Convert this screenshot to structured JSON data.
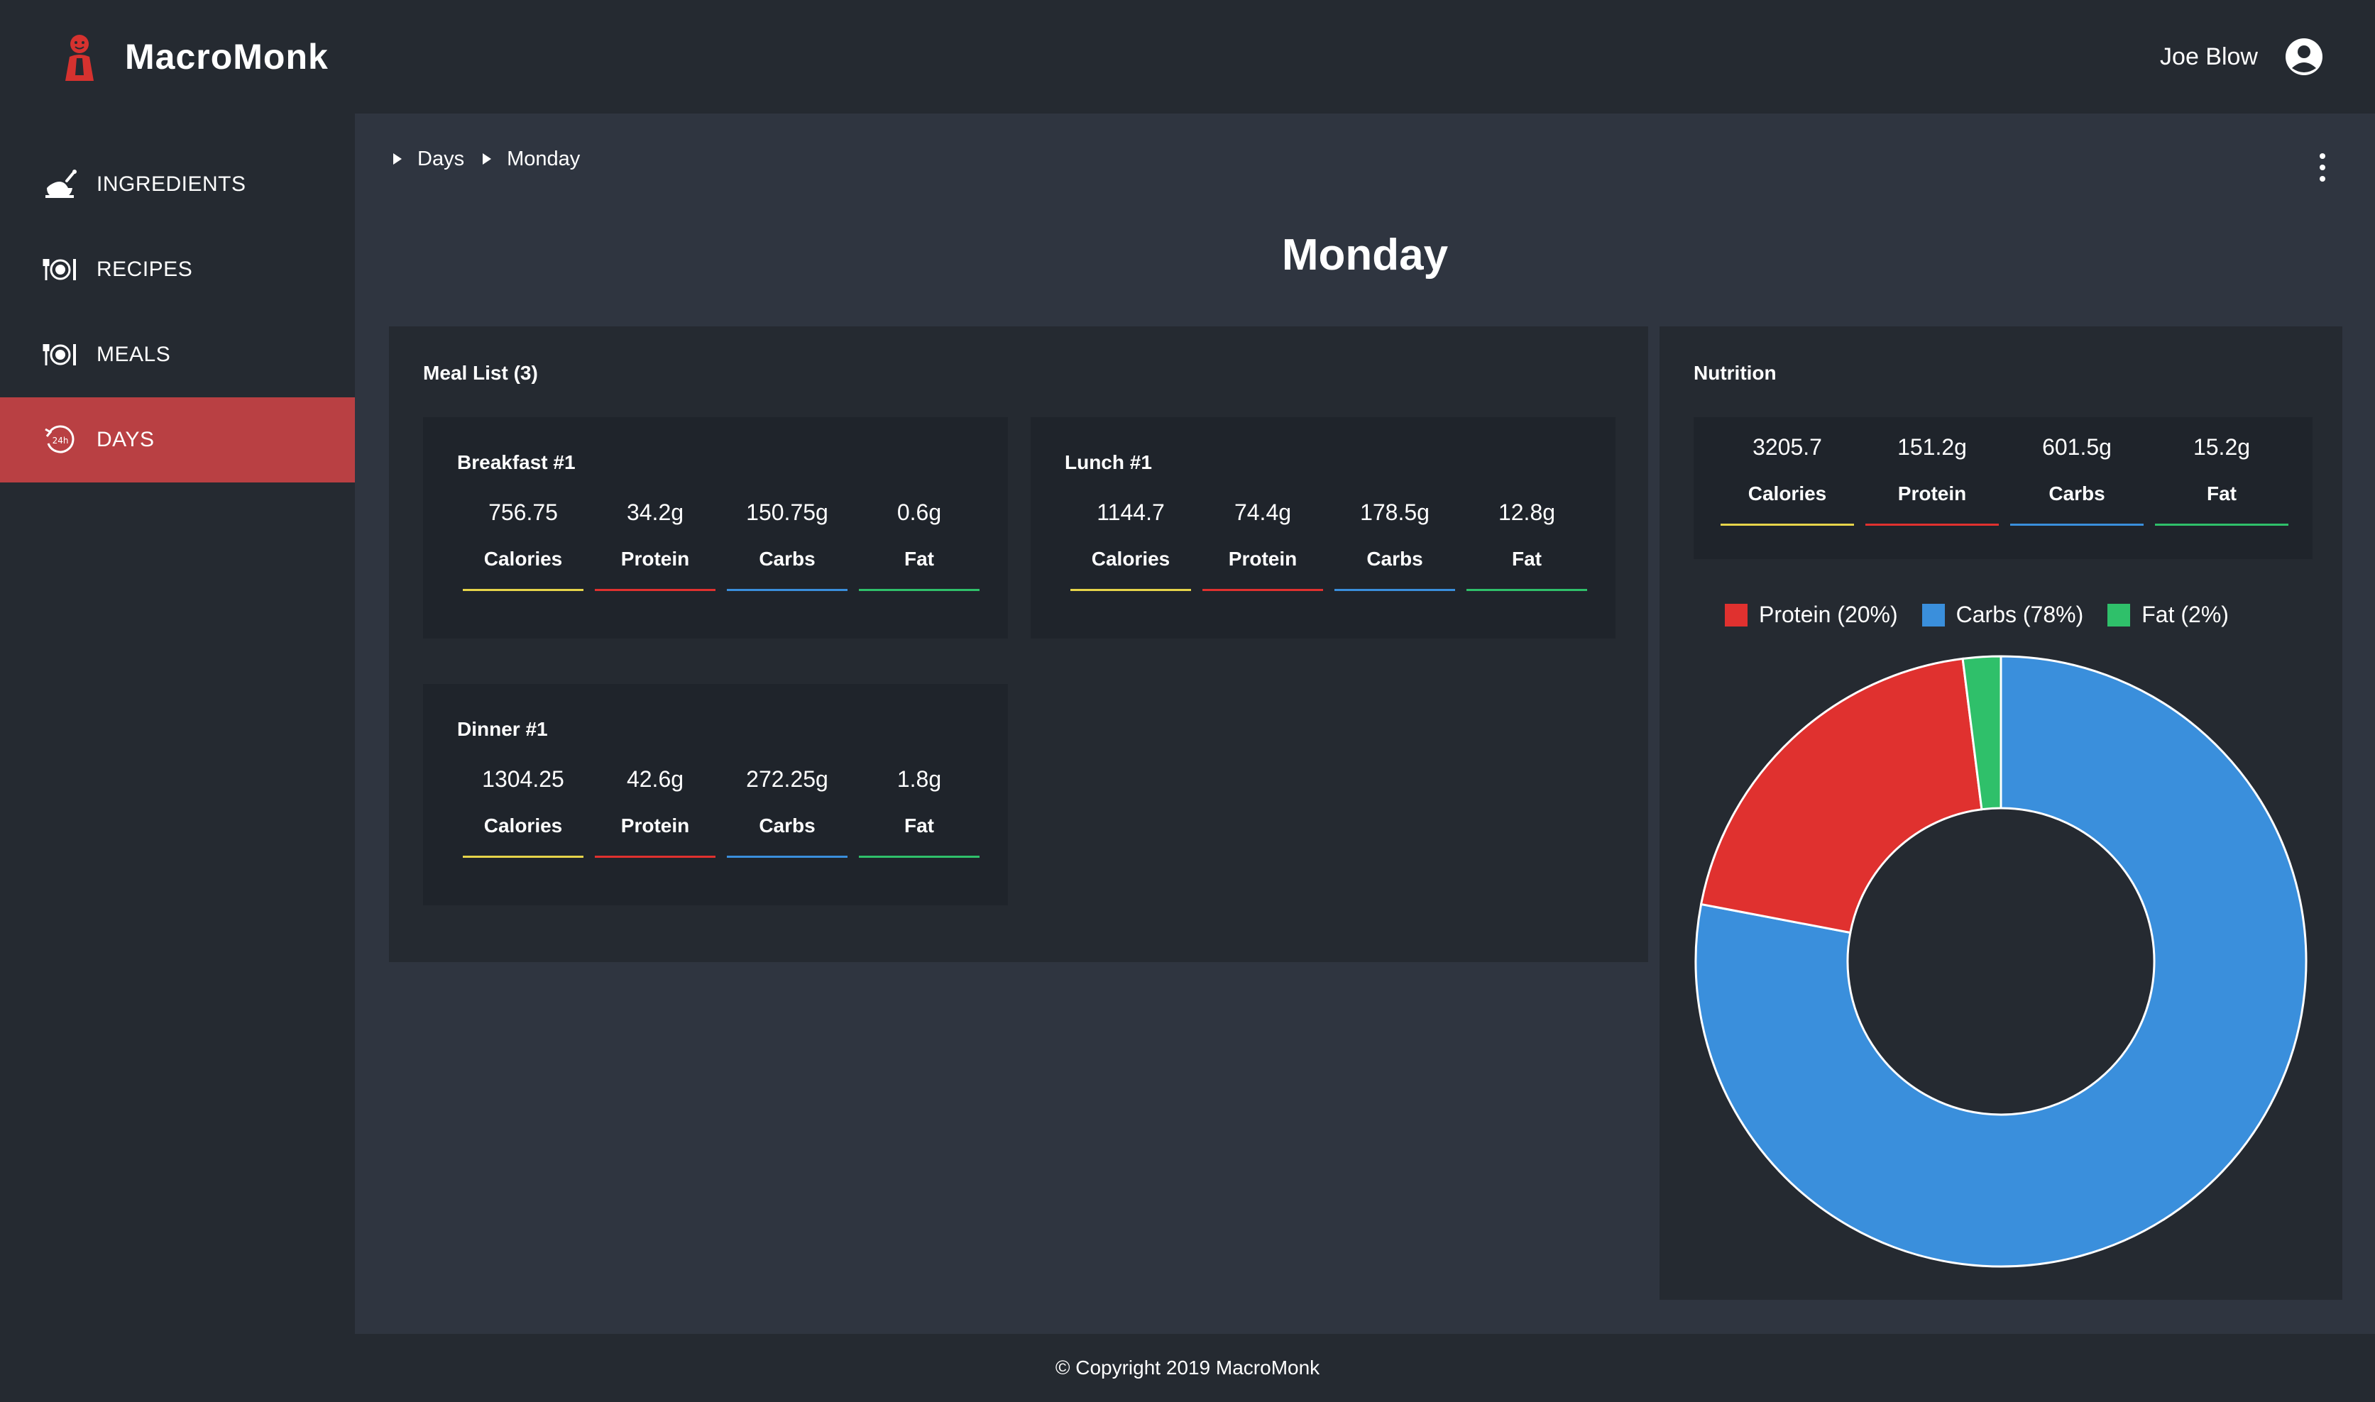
{
  "app": {
    "brand": "MacroMonk"
  },
  "user": {
    "name": "Joe Blow"
  },
  "colors": {
    "accent": "#b94043",
    "calories": "#e6d44a",
    "protein": "#e0312f",
    "carbs": "#3a8fdc",
    "fat": "#2fc06a"
  },
  "sidebar": {
    "items": [
      {
        "label": "INGREDIENTS",
        "icon": "chicken-icon"
      },
      {
        "label": "RECIPES",
        "icon": "plate-cutlery-icon"
      },
      {
        "label": "MEALS",
        "icon": "plate-cutlery-icon"
      },
      {
        "label": "DAYS",
        "icon": "24h-clock-icon",
        "active": true
      }
    ]
  },
  "breadcrumb": [
    "Days",
    "Monday"
  ],
  "page": {
    "title": "Monday"
  },
  "meal_list": {
    "title": "Meal List (3)",
    "meals": [
      {
        "name": "Breakfast #1",
        "stats": [
          {
            "value": "756.75",
            "label": "Calories"
          },
          {
            "value": "34.2g",
            "label": "Protein"
          },
          {
            "value": "150.75g",
            "label": "Carbs"
          },
          {
            "value": "0.6g",
            "label": "Fat"
          }
        ]
      },
      {
        "name": "Lunch #1",
        "stats": [
          {
            "value": "1144.7",
            "label": "Calories"
          },
          {
            "value": "74.4g",
            "label": "Protein"
          },
          {
            "value": "178.5g",
            "label": "Carbs"
          },
          {
            "value": "12.8g",
            "label": "Fat"
          }
        ]
      },
      {
        "name": "Dinner #1",
        "stats": [
          {
            "value": "1304.25",
            "label": "Calories"
          },
          {
            "value": "42.6g",
            "label": "Protein"
          },
          {
            "value": "272.25g",
            "label": "Carbs"
          },
          {
            "value": "1.8g",
            "label": "Fat"
          }
        ]
      }
    ]
  },
  "nutrition": {
    "title": "Nutrition",
    "stats": [
      {
        "value": "3205.7",
        "label": "Calories"
      },
      {
        "value": "151.2g",
        "label": "Protein"
      },
      {
        "value": "601.5g",
        "label": "Carbs"
      },
      {
        "value": "15.2g",
        "label": "Fat"
      }
    ]
  },
  "chart_data": {
    "type": "pie",
    "donut": true,
    "legend_position": "top",
    "categories": [
      "Protein (20%)",
      "Carbs (78%)",
      "Fat (2%)"
    ],
    "values": [
      20,
      78,
      2
    ],
    "colors": [
      "#e0312f",
      "#3a8fdc",
      "#2fc06a"
    ]
  },
  "footer": {
    "text": "© Copyright 2019 MacroMonk"
  }
}
